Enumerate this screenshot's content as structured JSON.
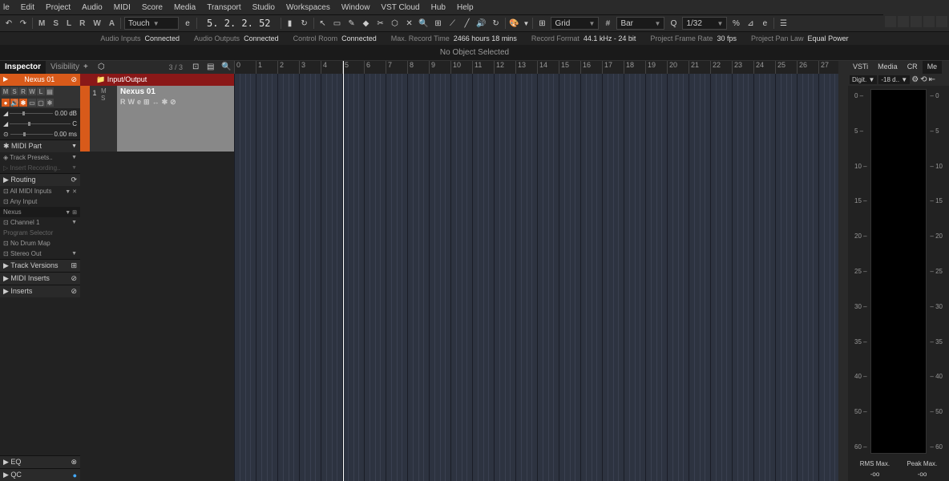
{
  "menu": [
    "le",
    "Edit",
    "Project",
    "Audio",
    "MIDI",
    "Score",
    "Media",
    "Transport",
    "Studio",
    "Workspaces",
    "Window",
    "VST Cloud",
    "Hub",
    "Help"
  ],
  "toolbar": {
    "btns1": [
      "M",
      "S",
      "L",
      "R",
      "W",
      "A"
    ],
    "automation": "Touch",
    "position": "5. 2. 2. 52",
    "snap": "Grid",
    "quantize": "Bar",
    "zoom": "1/32"
  },
  "status": [
    {
      "l": "Audio Inputs",
      "v": "Connected"
    },
    {
      "l": "Audio Outputs",
      "v": "Connected"
    },
    {
      "l": "Control Room",
      "v": "Connected"
    },
    {
      "l": "Max. Record Time",
      "v": "2466 hours 18 mins"
    },
    {
      "l": "Record Format",
      "v": "44.1 kHz - 24 bit"
    },
    {
      "l": "Project Frame Rate",
      "v": "30 fps"
    },
    {
      "l": "Project Pan Law",
      "v": "Equal Power"
    }
  ],
  "info": "No Object Selected",
  "inspector": {
    "tabs": [
      "Inspector",
      "Visibility"
    ],
    "track": "Nexus 01",
    "btns": [
      "M",
      "S",
      "R",
      "W",
      "L"
    ],
    "vol": "0.00 dB",
    "pan": "C",
    "delay": "0.00 ms",
    "sections": {
      "midi_part": "MIDI Part",
      "presets": "Track Presets..",
      "insert_rec": "Insert Recording..",
      "routing": "Routing",
      "all_midi": "All MIDI Inputs",
      "any_input": "Any Input",
      "inst": "Nexus",
      "channel": "Channel 1",
      "prog": "Program Selector",
      "drummap": "No Drum Map",
      "stereo": "Stereo Out",
      "versions": "Track Versions",
      "midi_ins": "MIDI Inserts",
      "inserts": "Inserts",
      "eq": "EQ",
      "qc": "QC"
    }
  },
  "tracklist": {
    "count": "3 / 3",
    "io": "Input/Output",
    "track": {
      "num": "1",
      "name": "Nexus 01",
      "btns": [
        "R",
        "W",
        "e"
      ]
    }
  },
  "ruler": [
    0,
    1,
    2,
    3,
    4,
    5,
    6,
    7,
    8,
    9,
    10,
    11,
    12,
    13,
    14,
    15,
    16,
    17,
    18,
    19,
    20,
    21,
    22,
    23,
    24,
    25,
    26,
    27
  ],
  "right": {
    "tabs": [
      "VSTi",
      "Media",
      "CR",
      "Me"
    ],
    "digit": "Digit.",
    "scale_sel": "-18 d..",
    "scale": [
      0,
      5,
      10,
      15,
      20,
      25,
      30,
      35,
      40,
      50,
      60
    ],
    "rms": "RMS Max.",
    "peak": "Peak Max.",
    "rmsv": "-oo",
    "peakv": "-oo"
  }
}
